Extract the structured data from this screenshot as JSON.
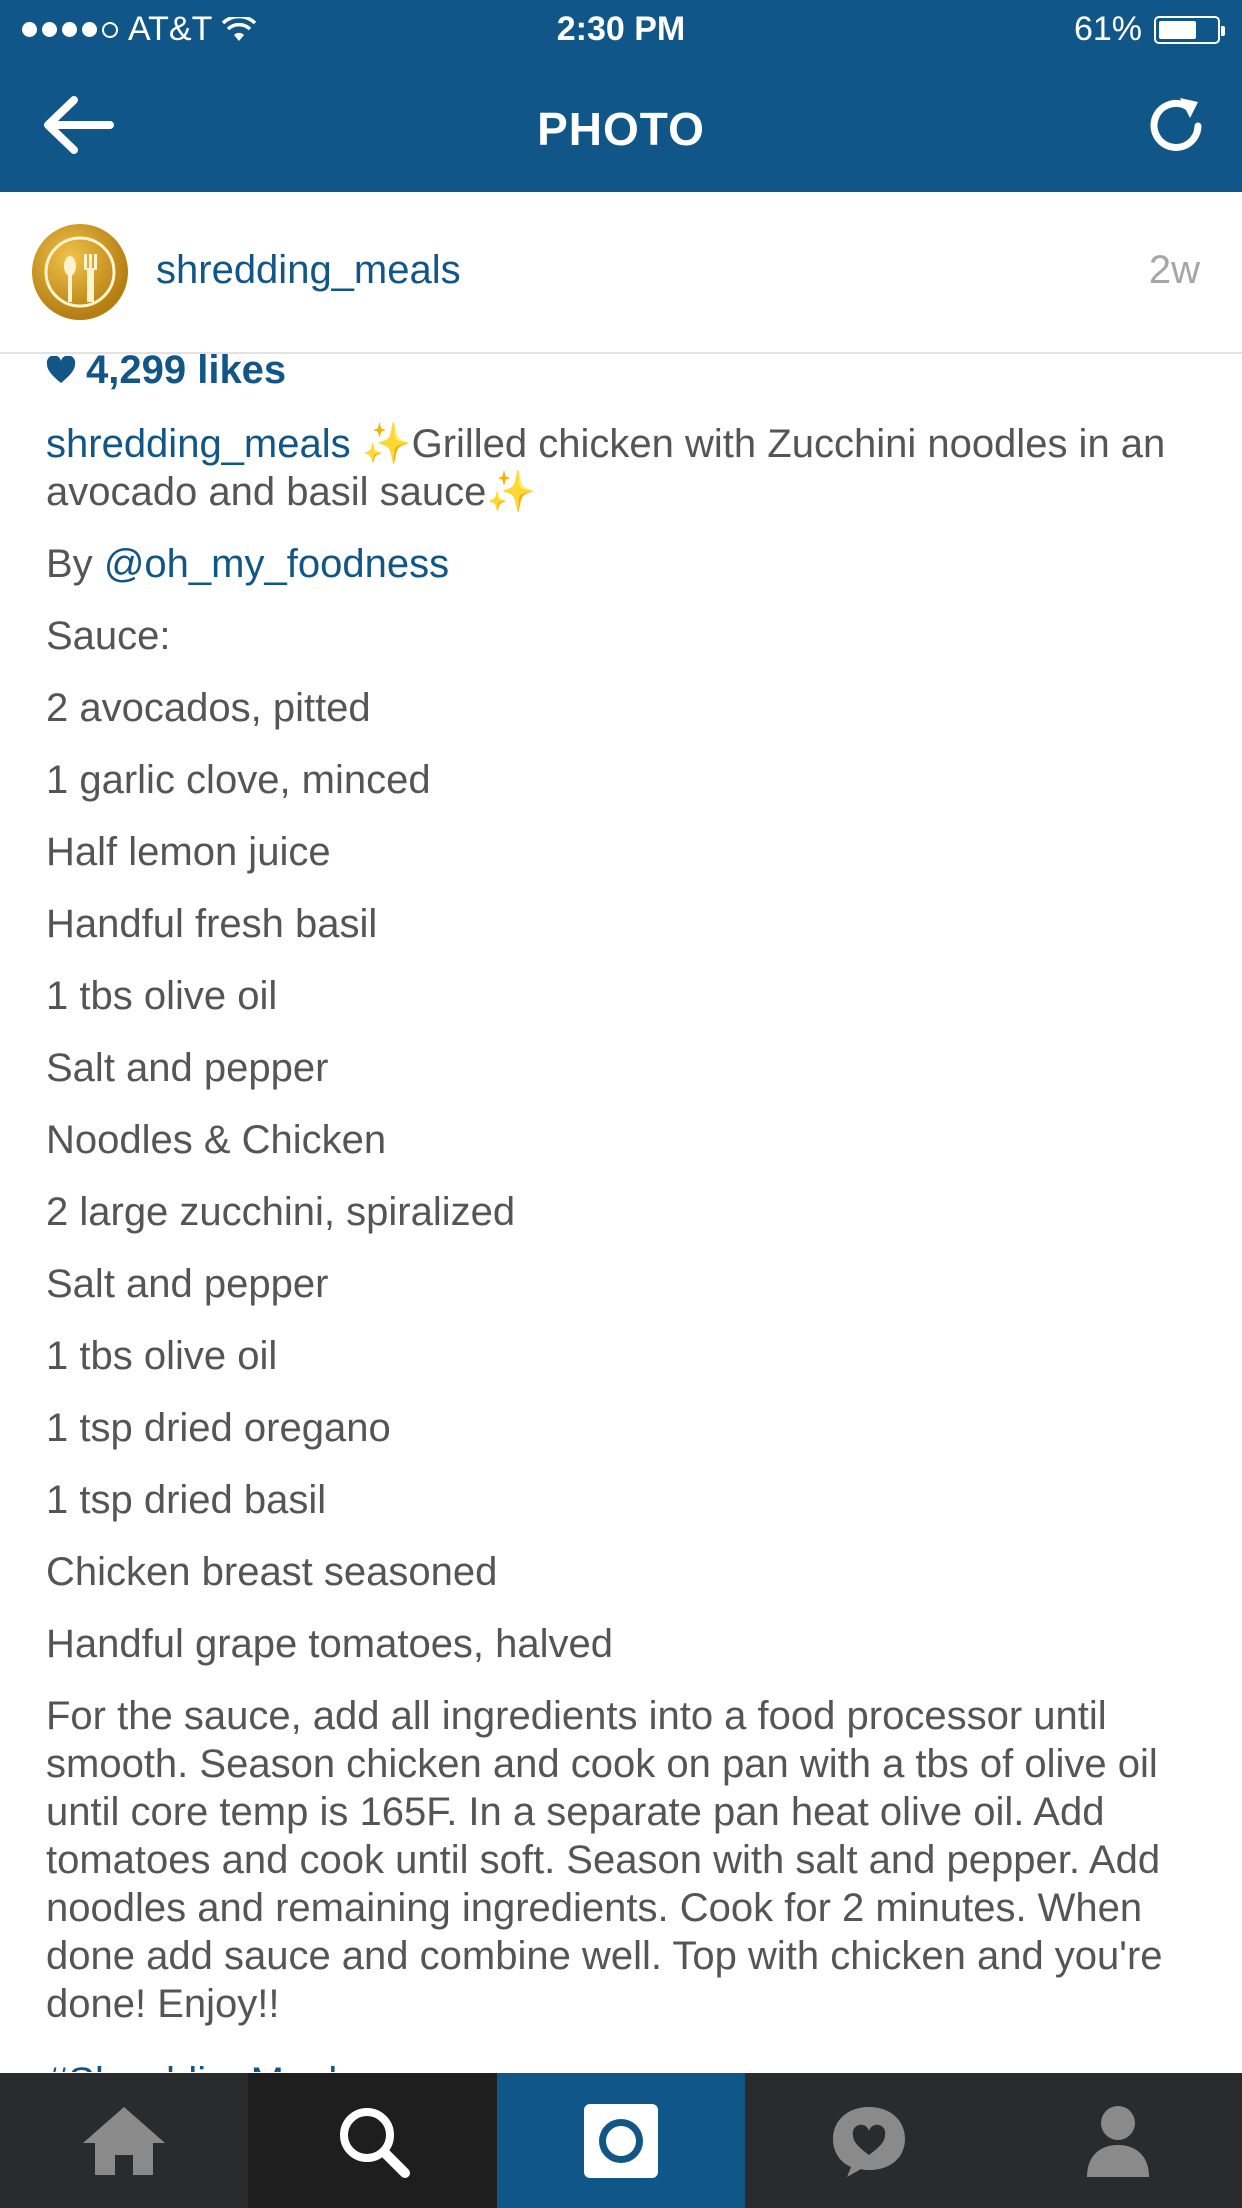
{
  "status_bar": {
    "carrier": "AT&T",
    "time": "2:30 PM",
    "battery": "61%",
    "battery_level": 0.61
  },
  "nav": {
    "title": "PHOTO"
  },
  "post": {
    "username": "shredding_meals",
    "time_ago": "2w",
    "likes": "4,299 likes",
    "caption_user": "shredding_meals",
    "caption_text": "Grilled chicken with Zucchini noodles in an avocado and basil sauce",
    "by_prefix": "By",
    "by_mention": "@oh_my_foodness",
    "lines": [
      "Sauce:",
      "2 avocados, pitted",
      "1 garlic clove, minced",
      "Half lemon juice",
      "Handful fresh basil",
      "1 tbs olive oil",
      "Salt and pepper",
      "Noodles & Chicken",
      "2 large zucchini, spiralized",
      "Salt and pepper",
      "1 tbs olive oil",
      "1 tsp dried oregano",
      "1 tsp dried basil",
      "Chicken breast seasoned",
      "Handful grape tomatoes, halved"
    ],
    "instructions": "For the sauce, add all ingredients into a food processor until smooth. Season chicken and cook on pan with a tbs of olive oil until core temp is 165F. In a separate pan heat olive oil. Add tomatoes and cook until soft. Season with salt and pepper. Add noodles and remaining ingredients. Cook for 2 minutes. When done add sauce and combine well. Top with chicken and you're done! Enjoy!!",
    "hashtag_partial": "#ShreddingMeals"
  },
  "colors": {
    "brand_blue": "#115689",
    "link_blue": "#125688",
    "tab_bar": "#2a2b2c"
  },
  "tabs": [
    {
      "name": "home",
      "icon": "home-icon"
    },
    {
      "name": "search",
      "icon": "search-icon"
    },
    {
      "name": "camera",
      "icon": "camera-icon"
    },
    {
      "name": "activity",
      "icon": "heart-bubble-icon"
    },
    {
      "name": "profile",
      "icon": "person-icon"
    }
  ]
}
